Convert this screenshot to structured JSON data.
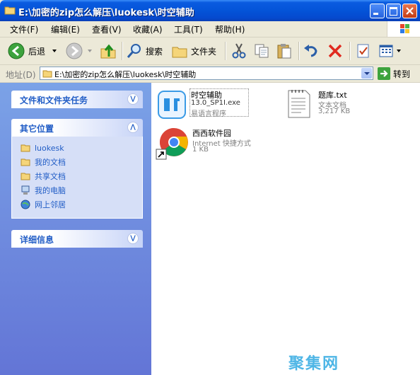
{
  "window": {
    "title": "E:\\加密的zip怎么解压\\luokesk\\时空辅助",
    "icon": "folder-icon"
  },
  "menu": {
    "items": [
      "文件(F)",
      "编辑(E)",
      "查看(V)",
      "收藏(A)",
      "工具(T)",
      "帮助(H)"
    ]
  },
  "toolbar": {
    "back_label": "后退",
    "search_label": "搜索",
    "folders_label": "文件夹"
  },
  "address": {
    "label": "地址(D)",
    "path": "E:\\加密的zip怎么解压\\luokesk\\时空辅助",
    "go_label": "转到"
  },
  "left_pane": {
    "tasks_title": "文件和文件夹任务",
    "other_places_title": "其它位置",
    "places": [
      {
        "label": "luokesk",
        "icon": "folder-icon"
      },
      {
        "label": "我的文档",
        "icon": "folder-icon"
      },
      {
        "label": "共享文档",
        "icon": "folder-icon"
      },
      {
        "label": "我的电脑",
        "icon": "computer-icon"
      },
      {
        "label": "网上邻居",
        "icon": "network-icon"
      }
    ],
    "details_title": "详细信息"
  },
  "files": [
    {
      "name": "时空辅助",
      "line2": "13.0_SP1I.exe",
      "line3": "易语言程序",
      "icon": "exe-app-icon"
    },
    {
      "name": "题库.txt",
      "line2": "文本文档",
      "line3": "3,217 KB",
      "icon": "text-file-icon"
    },
    {
      "name": "西西软件园",
      "line2": "Internet 快捷方式",
      "line3": "1 KB",
      "icon": "chrome-shortcut-icon"
    }
  ],
  "watermark": "聚集网",
  "colors": {
    "titlebar": "#0454D8",
    "left_pane": "#6F8FDF",
    "panel_text": "#215DC6",
    "watermark": "#4FB6E6"
  }
}
